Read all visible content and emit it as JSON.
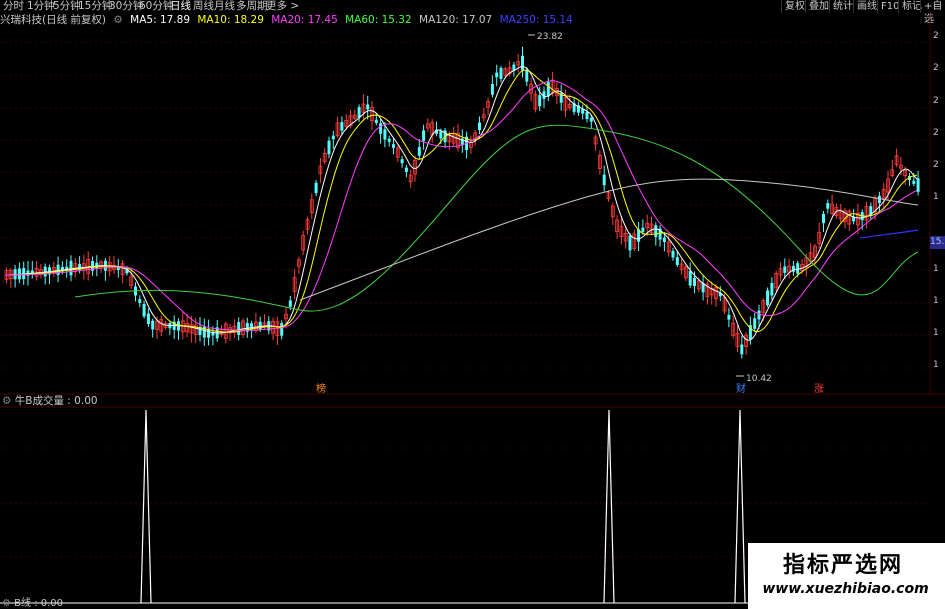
{
  "toolbar": {
    "tabs": [
      "分时",
      "1分钟",
      "5分钟",
      "15分钟",
      "30分钟",
      "60分钟",
      "日线",
      "周线",
      "月线",
      "多周期",
      "更多 >"
    ],
    "active_tab": "日线",
    "right_buttons": [
      "复权",
      "叠加",
      "统计",
      "画线",
      "F10",
      "标记",
      "+自选"
    ]
  },
  "main": {
    "title": "兴瑞科技(日线 前复权)",
    "ma": [
      {
        "label": "MA5: 17.89",
        "color": "#ffffff"
      },
      {
        "label": "MA10: 18.29",
        "color": "#ffff00"
      },
      {
        "label": "MA20: 17.45",
        "color": "#ff40ff"
      },
      {
        "label": "MA60: 15.32",
        "color": "#40ff40"
      },
      {
        "label": "MA120: 17.07",
        "color": "#c8c8c8"
      },
      {
        "label": "MA250: 15.14",
        "color": "#4040ff"
      }
    ],
    "high_label": "23.82",
    "low_label": "10.42",
    "price_tag": "15.",
    "scale_labels": [
      "2",
      "2",
      "2",
      "2",
      "2",
      "1",
      "1",
      "1",
      "1",
      "1",
      "1"
    ],
    "markers": [
      {
        "text": "榜",
        "color": "#ff8c00"
      },
      {
        "text": "财",
        "color": "#4080ff"
      },
      {
        "text": "涨",
        "color": "#ff4040"
      }
    ]
  },
  "sub": {
    "label": "牛B成交量 : 0.00",
    "bottom_label": "B线 : 0.00"
  },
  "watermark": {
    "cn": "指标严选网",
    "url": "www.xuezhibiao.com"
  },
  "chart_data": {
    "type": "line",
    "series": [
      {
        "name": "牛B成交量",
        "values": [
          0,
          0,
          0,
          1,
          0,
          0,
          0,
          1,
          0,
          1,
          0
        ]
      }
    ],
    "high": 23.82,
    "low": 10.42
  }
}
